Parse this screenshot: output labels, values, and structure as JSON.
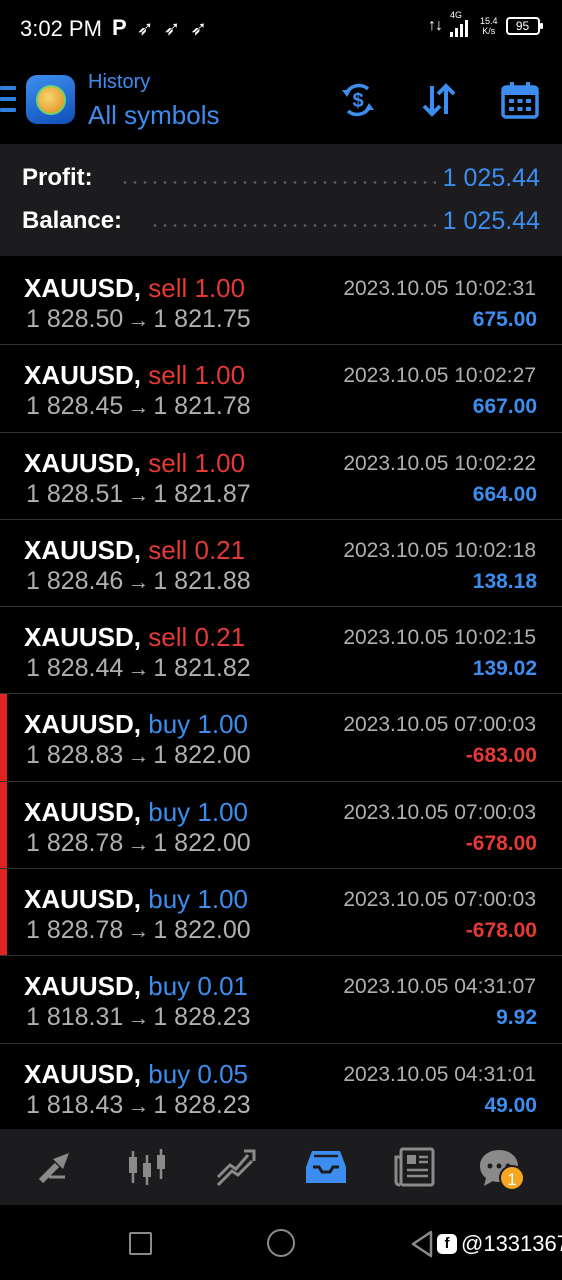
{
  "status_bar": {
    "time": "3:02 PM",
    "network_label": "4G",
    "speed_value": "15.4",
    "speed_unit": "K/s",
    "battery": "95"
  },
  "header": {
    "subtitle": "History",
    "title": "All symbols"
  },
  "summary": {
    "profit_label": "Profit:",
    "profit_value": "1 025.44",
    "balance_label": "Balance:",
    "balance_value": "1 025.44"
  },
  "deals": [
    {
      "symbol": "XAUUSD,",
      "type": "sell",
      "volume": "1.00",
      "time": "2023.10.05 10:02:31",
      "open_price": "1 828.50",
      "close_price": "1 821.75",
      "profit": "675.00"
    },
    {
      "symbol": "XAUUSD,",
      "type": "sell",
      "volume": "1.00",
      "time": "2023.10.05 10:02:27",
      "open_price": "1 828.45",
      "close_price": "1 821.78",
      "profit": "667.00"
    },
    {
      "symbol": "XAUUSD,",
      "type": "sell",
      "volume": "1.00",
      "time": "2023.10.05 10:02:22",
      "open_price": "1 828.51",
      "close_price": "1 821.87",
      "profit": "664.00"
    },
    {
      "symbol": "XAUUSD,",
      "type": "sell",
      "volume": "0.21",
      "time": "2023.10.05 10:02:18",
      "open_price": "1 828.46",
      "close_price": "1 821.88",
      "profit": "138.18"
    },
    {
      "symbol": "XAUUSD,",
      "type": "sell",
      "volume": "0.21",
      "time": "2023.10.05 10:02:15",
      "open_price": "1 828.44",
      "close_price": "1 821.82",
      "profit": "139.02"
    },
    {
      "symbol": "XAUUSD,",
      "type": "buy",
      "volume": "1.00",
      "time": "2023.10.05 07:00:03",
      "open_price": "1 828.83",
      "close_price": "1 822.00",
      "profit": "-683.00"
    },
    {
      "symbol": "XAUUSD,",
      "type": "buy",
      "volume": "1.00",
      "time": "2023.10.05 07:00:03",
      "open_price": "1 828.78",
      "close_price": "1 822.00",
      "profit": "-678.00"
    },
    {
      "symbol": "XAUUSD,",
      "type": "buy",
      "volume": "1.00",
      "time": "2023.10.05 07:00:03",
      "open_price": "1 828.78",
      "close_price": "1 822.00",
      "profit": "-678.00"
    },
    {
      "symbol": "XAUUSD,",
      "type": "buy",
      "volume": "0.01",
      "time": "2023.10.05 04:31:07",
      "open_price": "1 818.31",
      "close_price": "1 828.23",
      "profit": "9.92"
    },
    {
      "symbol": "XAUUSD,",
      "type": "buy",
      "volume": "0.05",
      "time": "2023.10.05 04:31:01",
      "open_price": "1 818.43",
      "close_price": "1 828.23",
      "profit": "49.00"
    }
  ],
  "arrow_glyph": "→",
  "bottom_nav": {
    "items": [
      "quotes-icon",
      "chart-icon",
      "trade-icon",
      "history-icon",
      "news-icon",
      "chat-icon"
    ],
    "active": "history-icon",
    "chat_badge": "1"
  },
  "watermark": "@1331367",
  "colors": {
    "accent": "#3d8df0",
    "sell": "#e53935",
    "loss_bar": "#e02424",
    "summary_bg": "#1c1c1e"
  }
}
